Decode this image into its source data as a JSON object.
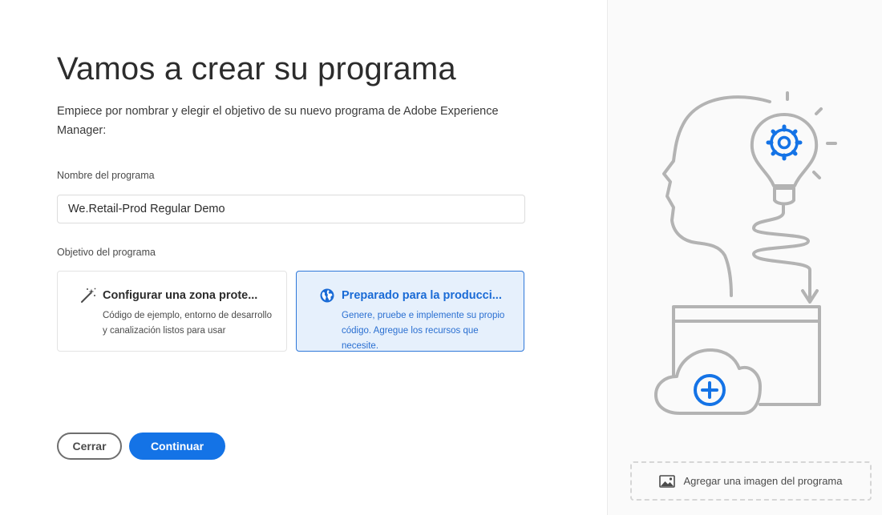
{
  "header": {
    "title": "Vamos a crear su programa",
    "subtitle": "Empiece por nombrar y elegir el objetivo de su nuevo programa de Adobe Experience Manager:"
  },
  "program_name": {
    "label": "Nombre del programa",
    "value": "We.Retail-Prod Regular Demo"
  },
  "program_goal": {
    "label": "Objetivo del programa",
    "options": [
      {
        "title": "Configurar una zona prote...",
        "description": "Código de ejemplo, entorno de desarrollo y canalización listos para usar",
        "icon": "magic-wand-icon",
        "selected": false
      },
      {
        "title": "Preparado para la producci...",
        "description": "Genere, pruebe e implemente su propio código. Agregue los recursos que necesite.",
        "icon": "globe-icon",
        "selected": true
      }
    ]
  },
  "actions": {
    "close_label": "Cerrar",
    "continue_label": "Continuar"
  },
  "side_panel": {
    "illustration": "head-lightbulb-cloud-illustration",
    "add_image_label": "Agregar una imagen del programa",
    "add_image_icon": "image-icon"
  },
  "colors": {
    "accent": "#1473e6",
    "selected_card_bg": "#e6f0fc",
    "illustration_gray": "#b3b3b3"
  }
}
